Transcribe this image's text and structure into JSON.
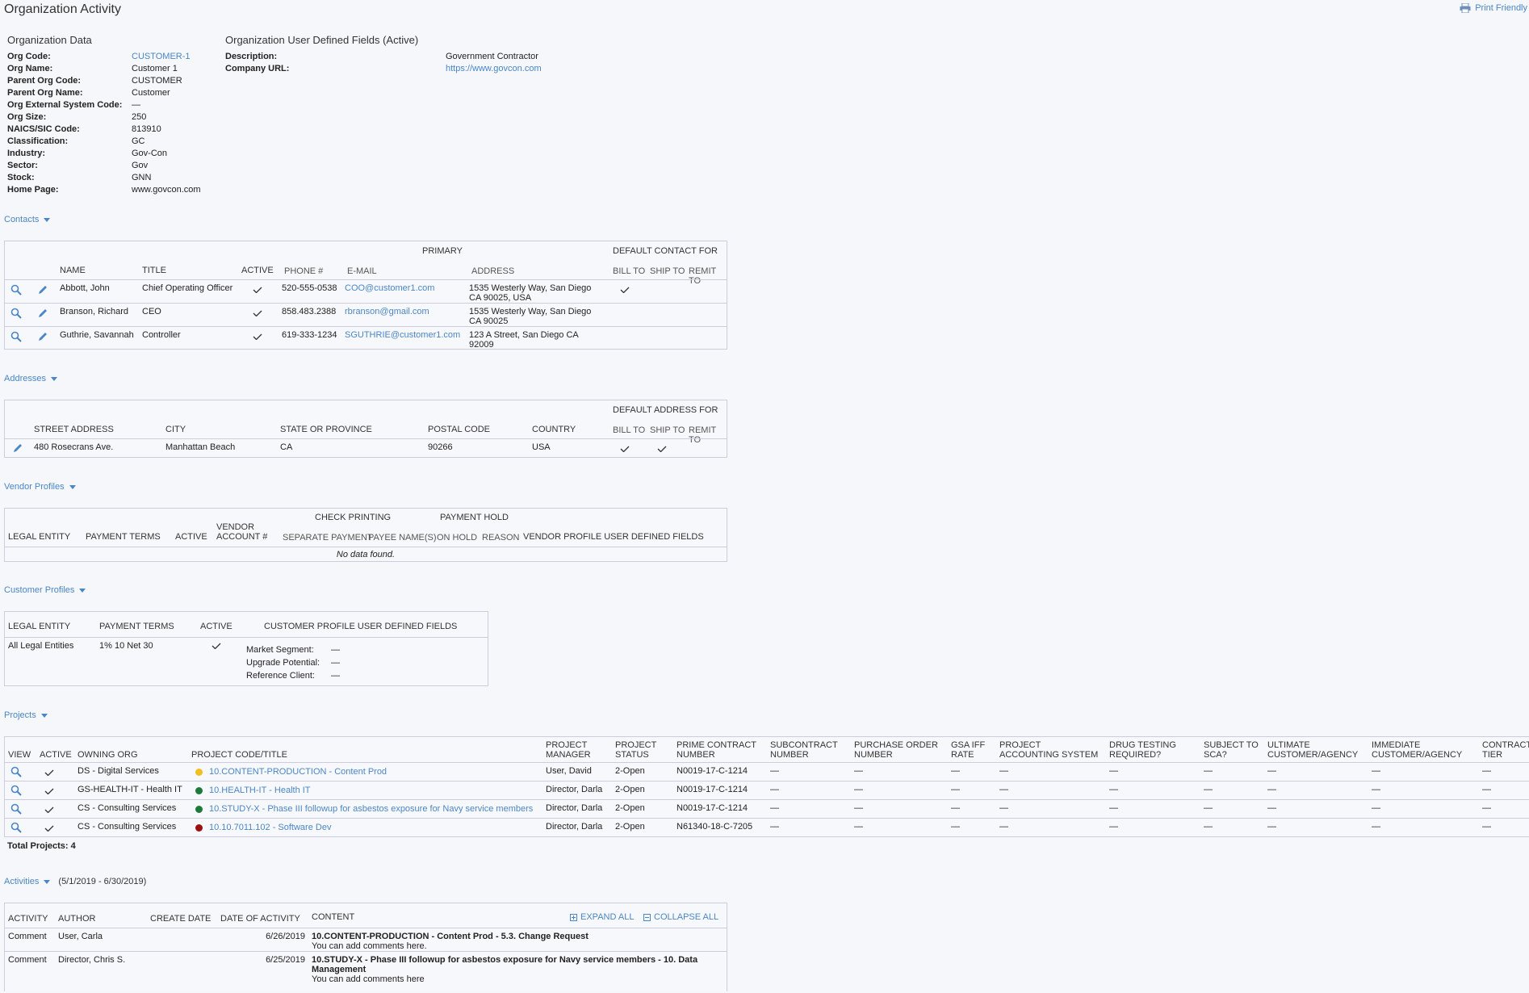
{
  "page": {
    "title": "Organization Activity",
    "print_label": "Print Friendly"
  },
  "org_data": {
    "heading": "Organization Data",
    "fields": [
      {
        "label": "Org Code:",
        "value": "CUSTOMER-1",
        "link": true
      },
      {
        "label": "Org Name:",
        "value": "Customer 1"
      },
      {
        "label": "Parent Org Code:",
        "value": "CUSTOMER"
      },
      {
        "label": "Parent Org Name:",
        "value": "Customer"
      },
      {
        "label": "Org External System Code:",
        "value": "—"
      },
      {
        "label": "Org Size:",
        "value": "250"
      },
      {
        "label": "NAICS/SIC Code:",
        "value": "813910"
      },
      {
        "label": "Classification:",
        "value": "GC"
      },
      {
        "label": "Industry:",
        "value": "Gov-Con"
      },
      {
        "label": "Sector:",
        "value": "Gov"
      },
      {
        "label": "Stock:",
        "value": "GNN"
      },
      {
        "label": "Home Page:",
        "value": "www.govcon.com"
      }
    ]
  },
  "udf": {
    "heading": "Organization User Defined Fields (Active)",
    "fields": [
      {
        "label": "Description:",
        "value": "Government Contractor"
      },
      {
        "label": "Company URL:",
        "value": "https://www.govcon.com",
        "link": true
      }
    ]
  },
  "contacts": {
    "toggle": "Contacts",
    "group_primary": "PRIMARY",
    "group_default": "DEFAULT CONTACT FOR",
    "headers": {
      "name": "NAME",
      "title": "TITLE",
      "active": "ACTIVE",
      "phone": "PHONE #",
      "email": "E-MAIL",
      "address": "ADDRESS",
      "bill": "BILL TO",
      "ship": "SHIP TO",
      "remit": "REMIT TO"
    },
    "rows": [
      {
        "name": "Abbott, John",
        "title": "Chief Operating Officer",
        "phone": "520-555-0538",
        "email": "COO@customer1.com",
        "addr1": "1535 Westerly Way, San Diego",
        "addr2": "CA 90025, USA",
        "bill": true
      },
      {
        "name": "Branson, Richard",
        "title": "CEO",
        "phone": "858.483.2388",
        "email": "rbranson@gmail.com",
        "addr1": "1535 Westerly Way, San Diego",
        "addr2": "CA 90025",
        "bill": false
      },
      {
        "name": "Guthrie, Savannah",
        "title": "Controller",
        "phone": "619-333-1234",
        "email": "SGUTHRIE@customer1.com",
        "addr1": "123 A Street, San Diego CA",
        "addr2": "92009",
        "bill": false
      }
    ]
  },
  "addresses": {
    "toggle": "Addresses",
    "group_default": "DEFAULT ADDRESS FOR",
    "headers": {
      "street": "STREET ADDRESS",
      "city": "CITY",
      "state": "STATE OR PROVINCE",
      "postal": "POSTAL CODE",
      "country": "COUNTRY",
      "bill": "BILL TO",
      "ship": "SHIP TO",
      "remit": "REMIT TO"
    },
    "rows": [
      {
        "street": "480 Rosecrans Ave.",
        "city": "Manhattan Beach",
        "state": "CA",
        "postal": "90266",
        "country": "USA"
      }
    ]
  },
  "vendor": {
    "toggle": "Vendor Profiles",
    "group_check": "CHECK PRINTING",
    "group_hold": "PAYMENT HOLD",
    "headers": {
      "legal": "LEGAL ENTITY",
      "terms": "PAYMENT TERMS",
      "active": "ACTIVE",
      "acct1": "VENDOR",
      "acct2": "ACCOUNT #",
      "sep": "SEPARATE PAYMENT",
      "payee": "PAYEE NAME(S)",
      "hold": "ON HOLD",
      "reason": "REASON",
      "udf": "VENDOR PROFILE USER DEFINED FIELDS"
    },
    "empty": "No data found."
  },
  "customer": {
    "toggle": "Customer Profiles",
    "headers": {
      "legal": "LEGAL ENTITY",
      "terms": "PAYMENT TERMS",
      "active": "ACTIVE",
      "udf": "CUSTOMER PROFILE USER DEFINED FIELDS"
    },
    "row": {
      "legal": "All Legal Entities",
      "terms": "1% 10 Net 30"
    },
    "udf": [
      {
        "label": "Market Segment:",
        "value": "—"
      },
      {
        "label": "Upgrade Potential:",
        "value": "—"
      },
      {
        "label": "Reference Client:",
        "value": "—"
      }
    ]
  },
  "projects": {
    "toggle": "Projects",
    "headers": {
      "view": "VIEW",
      "active": "ACTIVE",
      "org": "OWNING ORG",
      "code": "PROJECT CODE/TITLE",
      "pm1": "PROJECT",
      "pm2": "MANAGER",
      "st1": "PROJECT",
      "st2": "STATUS",
      "pc1": "PRIME CONTRACT",
      "pc2": "NUMBER",
      "sc1": "SUBCONTRACT",
      "sc2": "NUMBER",
      "po1": "PURCHASE ORDER",
      "po2": "NUMBER",
      "gsa1": "GSA IFF",
      "gsa2": "RATE",
      "pas1": "PROJECT",
      "pas2": "ACCOUNTING SYSTEM",
      "dt1": "DRUG TESTING",
      "dt2": "REQUIRED?",
      "sca1": "SUBJECT TO",
      "sca2": "SCA?",
      "uc1": "ULTIMATE",
      "uc2": "CUSTOMER/AGENCY",
      "ic1": "IMMEDIATE",
      "ic2": "CUSTOMER/AGENCY",
      "ct1": "CONTRACT",
      "ct2": "TIER"
    },
    "rows": [
      {
        "org": "DS - Digital Services",
        "color": "#f0c020",
        "code": "10.CONTENT-PRODUCTION - Content Prod",
        "pm": "User, David",
        "status": "2-Open",
        "prime": "N0019-17-C-1214"
      },
      {
        "org": "GS-HEALTH-IT - Health IT",
        "color": "#1e7a3a",
        "code": "10.HEALTH-IT - Health IT",
        "pm": "Director, Darla",
        "status": "2-Open",
        "prime": "N0019-17-C-1214"
      },
      {
        "org": "CS - Consulting Services",
        "color": "#1e7a3a",
        "code": "10.STUDY-X - Phase III followup for asbestos exposure for Navy service members",
        "pm": "Director, Darla",
        "status": "2-Open",
        "prime": "N0019-17-C-1214"
      },
      {
        "org": "CS - Consulting Services",
        "color": "#9b1010",
        "code": "10.10.7011.102 - Software Dev",
        "pm": "Director, Darla",
        "status": "2-Open",
        "prime": "N61340-18-C-7205"
      }
    ],
    "dash": "—",
    "total": "Total Projects: 4"
  },
  "activities": {
    "toggle": "Activities",
    "range": "(5/1/2019 - 6/30/2019)",
    "headers": {
      "activity": "ACTIVITY",
      "author": "AUTHOR",
      "create": "CREATE DATE",
      "date": "DATE OF ACTIVITY",
      "content": "CONTENT"
    },
    "expand": "EXPAND ALL",
    "collapse": "COLLAPSE ALL",
    "rows": [
      {
        "activity": "Comment",
        "author": "User, Carla",
        "date": "6/26/2019",
        "title1": "10.CONTENT-PRODUCTION - Content Prod - 5.3. Change Request",
        "title2": "",
        "body": "You can add comments here."
      },
      {
        "activity": "Comment",
        "author": "Director, Chris S.",
        "date": "6/25/2019",
        "title1": "10.STUDY-X - Phase III followup for asbestos exposure for Navy service members - 10. Data",
        "title2": "Management",
        "body": "You can add comments here"
      }
    ]
  }
}
